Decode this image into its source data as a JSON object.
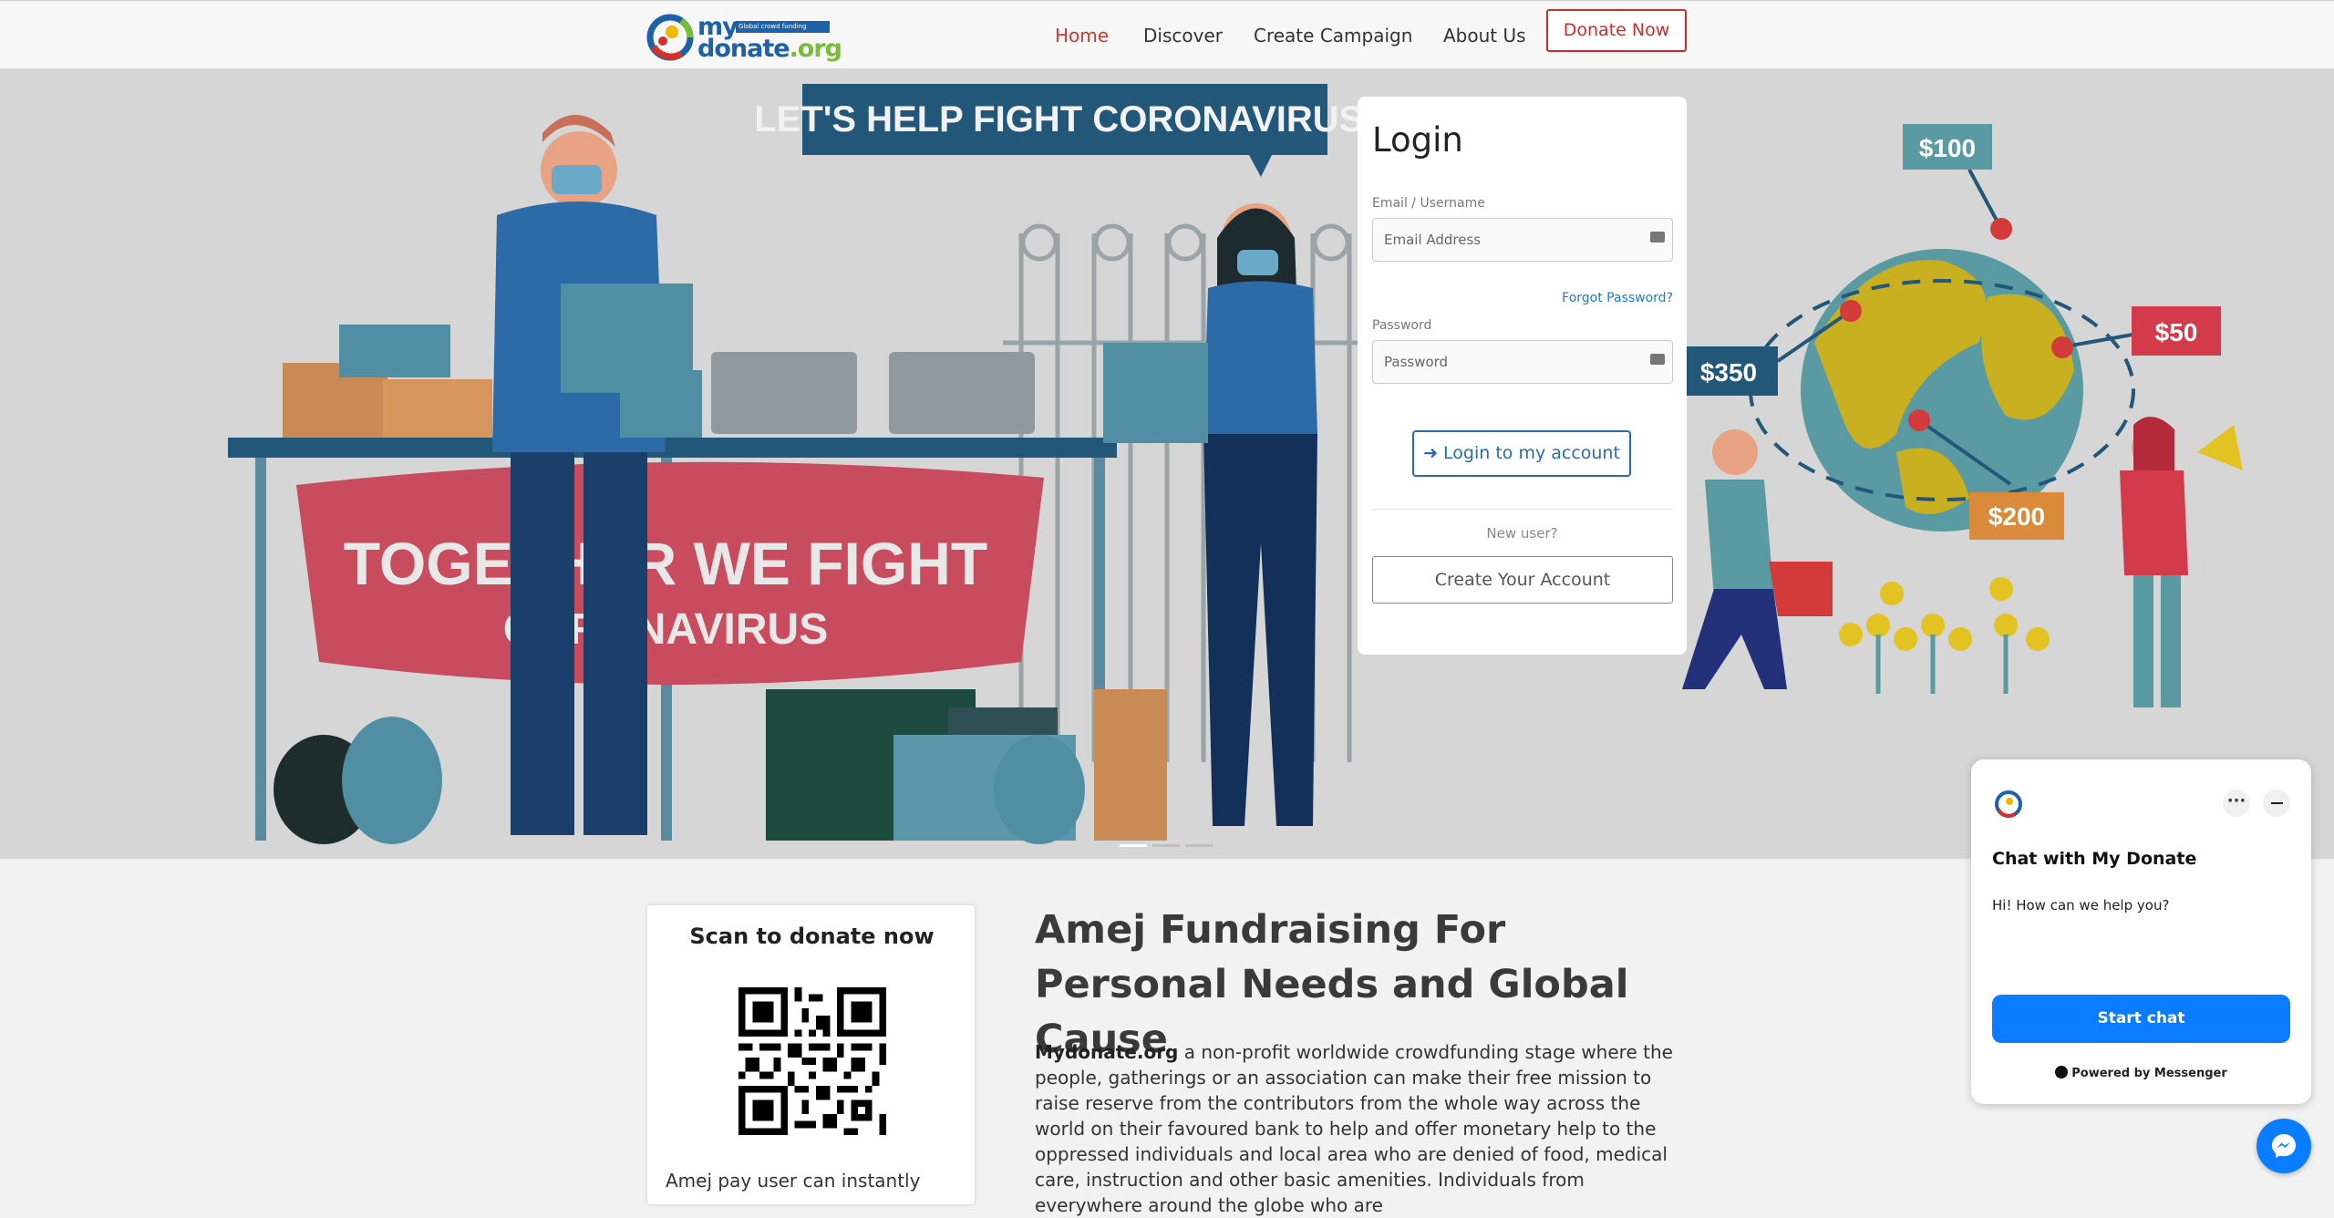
{
  "nav": {
    "logo": {
      "line1": "my",
      "tagline": "Global crowd funding platform",
      "line2_main": "donate",
      "line2_ext": ".org"
    },
    "items": [
      {
        "label": "Home",
        "active": true
      },
      {
        "label": "Discover"
      },
      {
        "label": "Create Campaign"
      },
      {
        "label": "About Us"
      }
    ],
    "donate_label": "Donate Now",
    "active_color": "#d33a2c"
  },
  "hero": {
    "banner_top": "LET'S HELP FIGHT CORONAVIRUS!",
    "banner_main_1": "TOGETHER WE FIGHT",
    "banner_main_2": "CORONAVIRUS",
    "tags": [
      "$100",
      "$50",
      "$350",
      "$200"
    ],
    "slide_count": 3,
    "active_slide": 1
  },
  "login": {
    "title": "Login",
    "email_label": "Email / Username",
    "email_placeholder": "Email Address",
    "forgot": "Forgot Password?",
    "password_label": "Password",
    "password_placeholder": "Password",
    "login_button": "Login to my account",
    "new_user": "New user?",
    "create_button": "Create Your Account",
    "accent": "#2a6ab3"
  },
  "qr": {
    "title": "Scan to donate now",
    "text": "Amej pay user can instantly"
  },
  "about": {
    "heading": "Amej Fundraising For Personal Needs and Global Cause",
    "brand": "Mydonate.org",
    "body": " a non-profit worldwide crowdfunding stage where the people, gatherings or an association can make their free mission to raise reserve from the contributors from the whole way across the world on their favoured bank to help and offer monetary help to the oppressed individuals and local area who are denied of food, medical care, instruction and other basic amenities. Individuals from everywhere around the globe who are"
  },
  "chat": {
    "title": "Chat with My Donate",
    "message": "Hi! How can we help you?",
    "start": "Start chat",
    "powered": "Powered by Messenger",
    "accent": "#0a7cff"
  }
}
